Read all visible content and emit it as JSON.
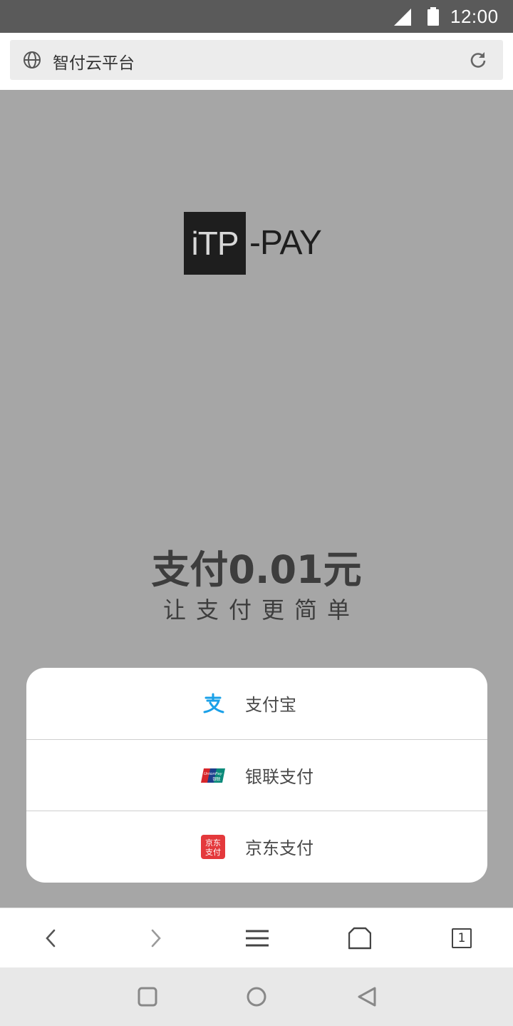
{
  "status_bar": {
    "time": "12:00",
    "icons": [
      "signal-icon",
      "battery-icon"
    ]
  },
  "address_bar": {
    "title": "智付云平台",
    "icons": [
      "globe-icon",
      "reload-icon"
    ]
  },
  "logo": {
    "boxed_text": "iTP",
    "rest_text": "-PAY"
  },
  "payment": {
    "amount_text": "支付0.01元",
    "slogan": "让支付更简单"
  },
  "pay_options": [
    {
      "label": "支付宝",
      "icon": "alipay-icon",
      "color": "#1aa0e8"
    },
    {
      "label": "银联支付",
      "icon": "unionpay-icon",
      "color": "#d7262b"
    },
    {
      "label": "京东支付",
      "icon": "jdpay-icon",
      "color": "#e4393c"
    }
  ],
  "unionpay_icon_text": "UnionPay 银联",
  "jdpay_icon_text": [
    "京东",
    "支付"
  ],
  "browser_toolbar": {
    "tab_count": "1",
    "icons": [
      "back-icon",
      "forward-icon",
      "menu-icon",
      "home-icon",
      "tabs-icon"
    ]
  },
  "nav_bar": {
    "icons": [
      "recents-icon",
      "home-circle-icon",
      "back-triangle-icon"
    ]
  },
  "colors": {
    "status_bar": "#5a5a5a",
    "page_background": "#a6a6a6",
    "address_bar": "#ececec",
    "nav_bar": "#e8e8e8"
  }
}
